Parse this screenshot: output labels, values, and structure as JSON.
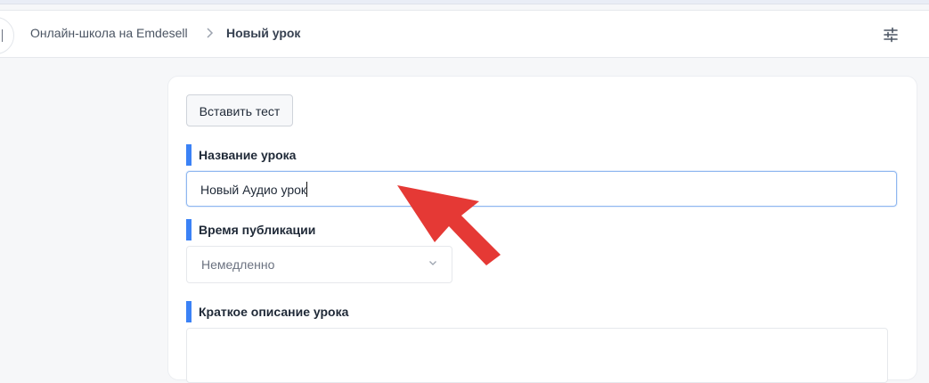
{
  "header": {
    "breadcrumb_root": "Онлайн-школа на Emdesell",
    "breadcrumb_separator": "chevron-right-icon",
    "breadcrumb_current": "Новый урок",
    "settings_icon": "sliders-icon"
  },
  "form": {
    "insert_test_label": "Вставить тест",
    "lesson_name_label": "Название урока",
    "lesson_name_value": "Новый Аудио урок",
    "publish_time_label": "Время публикации",
    "publish_time_value": "Немедленно",
    "short_description_label": "Краткое описание урока",
    "short_description_value": ""
  },
  "colors": {
    "accent": "#3b82f6",
    "annotation_arrow": "#e53935",
    "input_focus_border": "#8fb7f0"
  }
}
